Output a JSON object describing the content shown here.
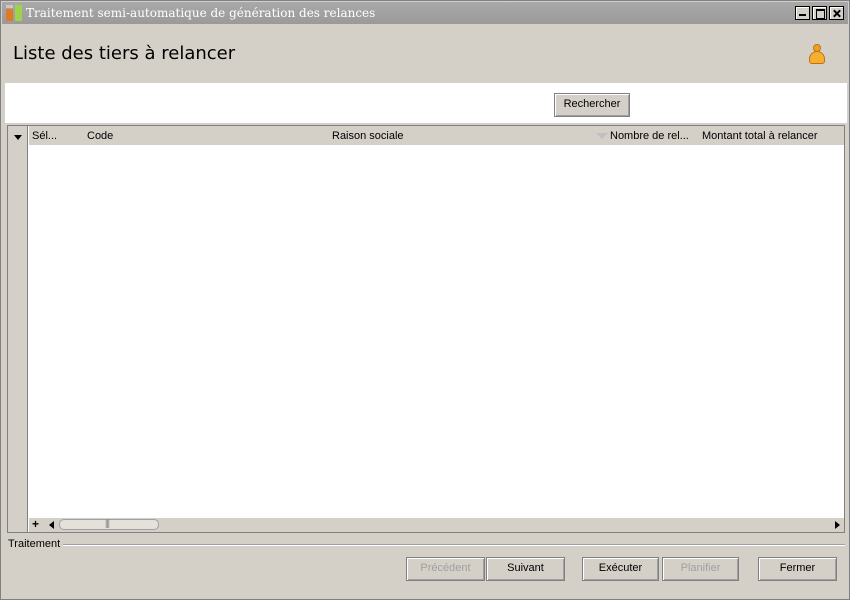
{
  "window": {
    "title": "Traitement semi-automatique de génération des relances"
  },
  "header": {
    "title": "Liste des tiers à relancer"
  },
  "search": {
    "button_label": "Rechercher"
  },
  "grid": {
    "columns": [
      "Sél...",
      "Code",
      "Raison sociale",
      "Nombre de rel...",
      "Montant total à relancer"
    ],
    "rows": []
  },
  "footer": {
    "section_label": "Traitement",
    "buttons": {
      "previous": "Précédent",
      "next": "Suivant",
      "execute": "Exécuter",
      "schedule": "Planifier",
      "close": "Fermer"
    }
  }
}
